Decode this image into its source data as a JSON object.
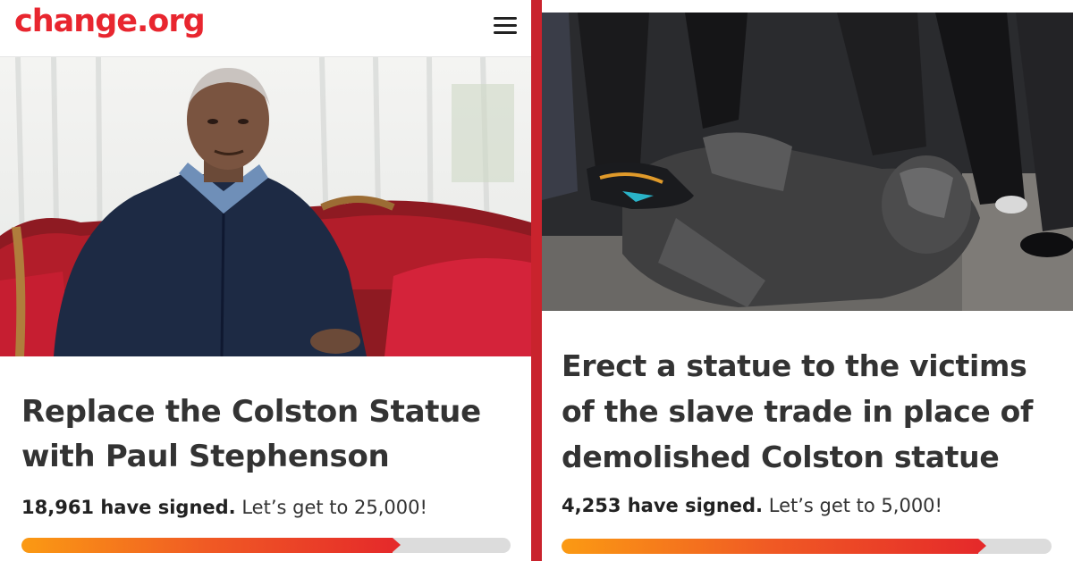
{
  "colors": {
    "brand_red": "#e8262f",
    "divider": "#c9232d",
    "progress_start": "#fb9a13",
    "progress_end": "#e52a2a",
    "track": "#dcdcdc"
  },
  "left": {
    "logo": "change.org",
    "menu_icon": "hamburger-menu-icon",
    "photo_alt": "Paul Stephenson seated on a red sofa",
    "title": "Replace the Colston Statue with Paul Stephenson",
    "signed_label": "18,961 have signed.",
    "goal_label": "Let’s get to 25,000!",
    "progress": 0.7584
  },
  "right": {
    "photo_alt": "Toppled Colston statue on the ground",
    "title": "Erect a statue to the victims of the slave trade in place of demolished Colston statue",
    "signed_label": "4,253 have signed.",
    "goal_label": "Let’s get to 5,000!",
    "progress": 0.8506
  }
}
